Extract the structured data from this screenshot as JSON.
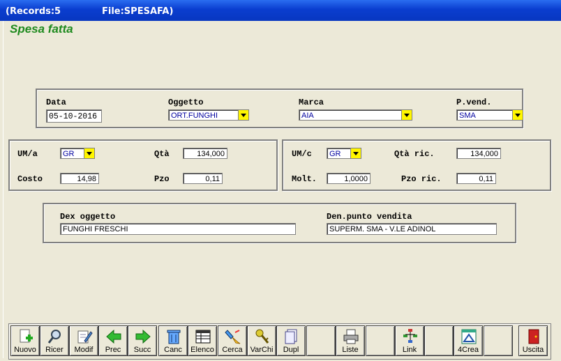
{
  "titlebar": {
    "records": "(Records:5",
    "file": "File:SPESAFA)"
  },
  "form": {
    "title": "Spesa fatta"
  },
  "top_group": {
    "data_label": "Data",
    "data_value": "05-10-2016",
    "oggetto_label": "Oggetto",
    "oggetto_value": "ORT.FUNGHI",
    "marca_label": "Marca",
    "marca_value": "AIA",
    "pvend_label": "P.vend.",
    "pvend_value": "SMA"
  },
  "left_group": {
    "uma_label": "UM/a",
    "uma_value": "GR",
    "qta_label": "Qtà",
    "qta_value": "134,000",
    "costo_label": "Costo",
    "costo_value": "14,98",
    "pzo_label": "Pzo",
    "pzo_value": "0,11"
  },
  "right_group": {
    "umc_label": "UM/c",
    "umc_value": "GR",
    "qtaric_label": "Qtà ric.",
    "qtaric_value": "134,000",
    "molt_label": "Molt.",
    "molt_value": "1,0000",
    "pzoric_label": "Pzo ric.",
    "pzoric_value": "0,11"
  },
  "bottom_group": {
    "dex_label": "Dex oggetto",
    "dex_value": "FUNGHI FRESCHI",
    "den_label": "Den.punto vendita",
    "den_value": "SUPERM. SMA - V.LE ADINOL"
  },
  "toolbar": {
    "buttons": [
      {
        "label": "Nuovo",
        "icon": "new-doc-icon"
      },
      {
        "label": "Ricer",
        "icon": "magnifier-icon"
      },
      {
        "label": "Modif",
        "icon": "edit-icon"
      },
      {
        "label": "Prec",
        "icon": "arrow-left-icon"
      },
      {
        "label": "Succ",
        "icon": "arrow-right-icon"
      },
      {
        "label": "Canc",
        "icon": "trash-icon"
      },
      {
        "label": "Elenco",
        "icon": "list-icon"
      },
      {
        "label": "Cerca",
        "icon": "search-brush-icon"
      },
      {
        "label": "VarChi",
        "icon": "keys-icon"
      },
      {
        "label": "Dupl",
        "icon": "duplicate-icon"
      },
      {
        "label": "",
        "icon": ""
      },
      {
        "label": "Liste",
        "icon": "printer-icon"
      },
      {
        "label": "",
        "icon": ""
      },
      {
        "label": "Link",
        "icon": "tree-icon"
      },
      {
        "label": "",
        "icon": ""
      },
      {
        "label": "4Crea",
        "icon": "crea-icon"
      },
      {
        "label": "",
        "icon": ""
      },
      {
        "label": "Uscita",
        "icon": "exit-door-icon"
      }
    ]
  },
  "colors": {
    "title_green": "#1E8A1E",
    "titlebar_blue": "#0a3dcf",
    "combo_yellow": "#FFF600",
    "field_text": "#0000A0"
  }
}
